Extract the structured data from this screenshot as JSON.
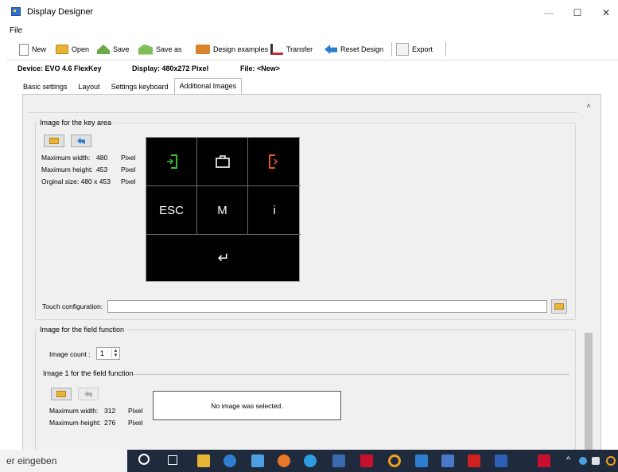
{
  "window": {
    "title": "Display Designer",
    "controls": {
      "minimize": "—",
      "maximize": "☐",
      "close": "✕"
    }
  },
  "menu": {
    "file": "File"
  },
  "toolbar": {
    "new": "New",
    "open": "Open",
    "save": "Save",
    "save_as": "Save as",
    "design_examples": "Design examples",
    "transfer": "Transfer",
    "reset_design": "Reset Design",
    "export": "Export"
  },
  "info": {
    "device": "Device: EVO 4.6 FlexKey",
    "display": "Display: 480x272 Pixel",
    "file": "File: <New>"
  },
  "tabs": [
    "Basic settings",
    "Layout",
    "Settings keyboard",
    "Additional Images"
  ],
  "key_area": {
    "group_title": "Image for the key area",
    "max_width_label": "Maximum width:",
    "max_width_value": "480",
    "max_width_unit": "Pixel",
    "max_height_label": "Maximum height:",
    "max_height_value": "453",
    "max_height_unit": "Pixel",
    "orig_size_label": "Orginal size: 480 x 453",
    "orig_size_unit": "Pixel",
    "keys": {
      "esc": "ESC",
      "m": "M",
      "i": "i",
      "enter": "↵"
    },
    "touch_config_label": "Touch configuration:",
    "touch_config_value": ""
  },
  "field_function": {
    "group_title": "Image for the field function",
    "image_count_label": "Image count :",
    "image_count_value": "1",
    "image1_title": "Image 1 for the field function",
    "max_width_label": "Maximum width:",
    "max_width_value": "312",
    "max_width_unit": "Pixel",
    "max_height_label": "Maximum height:",
    "max_height_value": "276",
    "max_height_unit": "Pixel",
    "no_image_text": "No image was selected."
  },
  "taskbar": {
    "search_text": "er eingeben"
  },
  "colors": {
    "key_green": "#37c22e",
    "key_orange": "#e85a1d",
    "keypad_bg": "#000000",
    "taskbar_bg": "#1f2a3c"
  }
}
